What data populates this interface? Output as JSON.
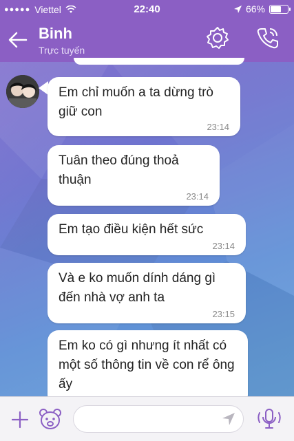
{
  "status_bar": {
    "carrier": "Viettel",
    "time": "22:40",
    "battery_text": "66%",
    "battery_level": 0.66,
    "signal_dots": "●●●●●"
  },
  "header": {
    "contact_name": "Binh",
    "contact_status": "Trực tuyến",
    "icons": [
      "back-arrow-icon",
      "settings-gear-icon",
      "phone-call-icon"
    ]
  },
  "messages": [
    {
      "text": "Em chỉ muốn a ta dừng trò giữ con",
      "time": "23:14"
    },
    {
      "text": "Tuân theo đúng thoả thuận",
      "time": "23:14"
    },
    {
      "text": "Em tạo điều kiện hết sức",
      "time": "23:14"
    },
    {
      "text": "Và e ko muốn dính dáng gì đến nhà vợ anh ta",
      "time": "23:15"
    },
    {
      "text": "Em ko có gì nhưng ít nhất có một số thông tin về con rể ông ấy",
      "time": ""
    }
  ],
  "input_bar": {
    "placeholder": "",
    "icons": [
      "plus-icon",
      "sticker-bear-icon",
      "send-arrow-icon",
      "voice-mic-icon"
    ]
  },
  "colors": {
    "header": "#8b5fc4",
    "accent": "#8b5fc4",
    "bubble": "#ffffff"
  }
}
